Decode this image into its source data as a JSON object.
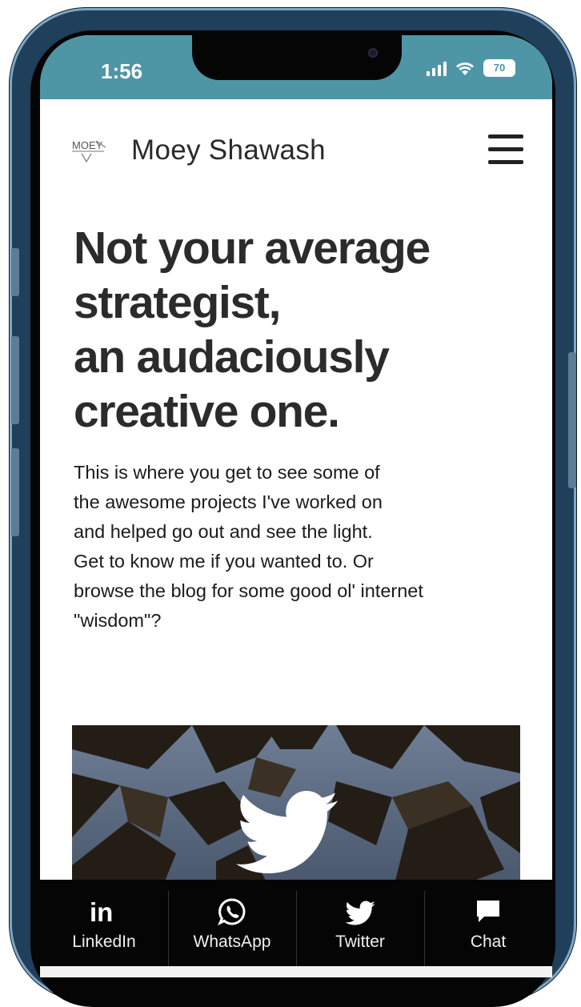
{
  "status_bar": {
    "time": "1:56",
    "battery": "70",
    "bg_color": "#4e96a6"
  },
  "header": {
    "logo_icon": "moey-logo-icon",
    "logo_text": "MOEY",
    "brand_name": "Moey Shawash",
    "menu_icon": "hamburger-menu-icon"
  },
  "hero": {
    "headline_lines": [
      "Not your average",
      "strategist,",
      "an audaciously",
      "creative one."
    ],
    "intro_lines": [
      "This is where you get to see some of",
      "the awesome projects I've worked on",
      "and helped go out and see the light.",
      "Get to know me if you wanted to. Or",
      "browse the blog for some good ol' internet",
      "\"wisdom\"?"
    ],
    "image_icon": "twitter-bird-icon"
  },
  "social_bar": {
    "items": [
      {
        "label": "LinkedIn",
        "icon": "linkedin-icon"
      },
      {
        "label": "WhatsApp",
        "icon": "whatsapp-icon"
      },
      {
        "label": "Twitter",
        "icon": "twitter-icon"
      },
      {
        "label": "Chat",
        "icon": "chat-icon"
      }
    ]
  }
}
